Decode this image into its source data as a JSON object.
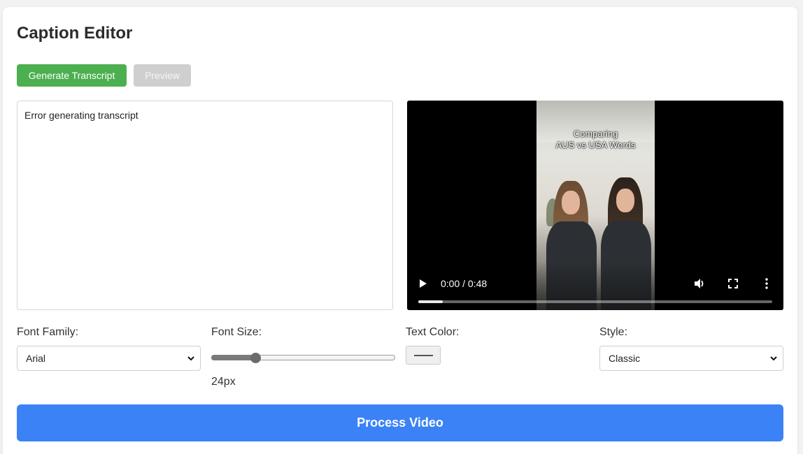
{
  "editor": {
    "title": "Caption Editor",
    "generate_label": "Generate Transcript",
    "preview_label": "Preview",
    "transcript_text": "Error generating transcript"
  },
  "video": {
    "caption_line1": "Comparing",
    "caption_line2": "AUS vs USA Words",
    "time": "0:00 / 0:48",
    "progress_fraction": 0.07
  },
  "settings": {
    "font_family_label": "Font Family:",
    "font_family_value": "Arial",
    "font_size_label": "Font Size:",
    "font_size_value": "24px",
    "font_size_fraction": 0.24,
    "text_color_label": "Text Color:",
    "text_color_value": "#555555",
    "style_label": "Style:",
    "style_value": "Classic"
  },
  "actions": {
    "process_label": "Process Video"
  },
  "colors": {
    "generate_button": "#4caf50",
    "preview_button": "#cfcfcf",
    "process_button": "#3b82f6"
  },
  "icons": {
    "play": "play-icon",
    "volume": "volume-icon",
    "fullscreen": "fullscreen-icon",
    "more": "more-vertical-icon",
    "chevron": "chevron-down-icon"
  }
}
